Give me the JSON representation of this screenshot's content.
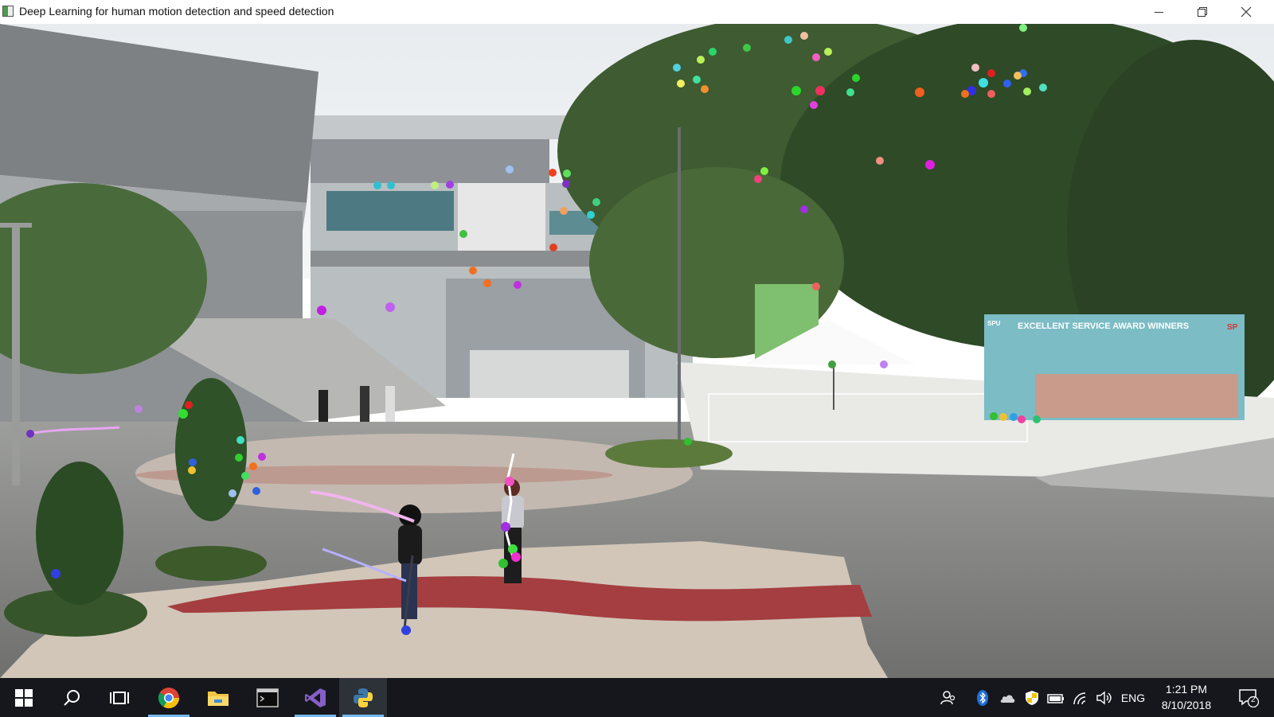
{
  "window": {
    "title": "Deep Learning for human motion detection and speed detection"
  },
  "scene": {
    "billboard_title": "EXCELLENT SERVICE AWARD WINNERS",
    "billboard_logo": "SP",
    "billboard_logo_left": "SPU"
  },
  "taskbar": {
    "apps": [
      "start",
      "search",
      "task-view",
      "chrome",
      "file-explorer",
      "terminal",
      "visual-studio",
      "python"
    ],
    "language": "ENG",
    "time": "1:21 PM",
    "date": "8/10/2018",
    "notification_count": "2"
  },
  "colors": {
    "taskbar_bg": "#15171c",
    "accent": "#76b9ed"
  }
}
